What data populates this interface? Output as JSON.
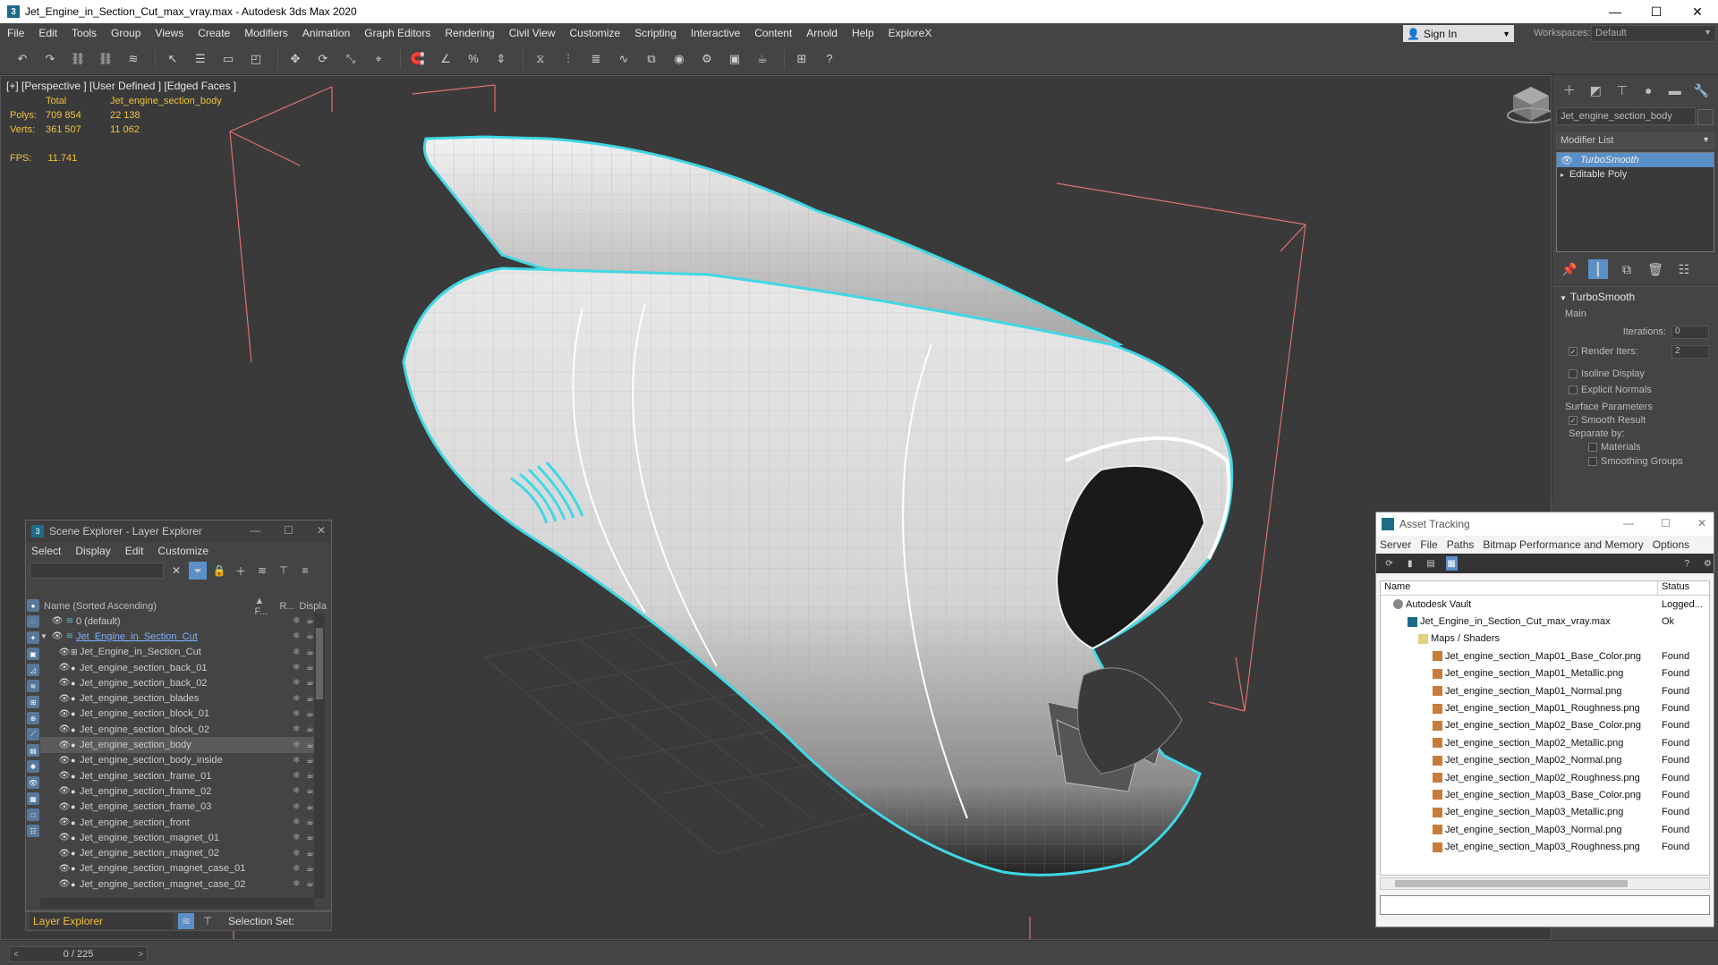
{
  "window": {
    "title": "Jet_Engine_in_Section_Cut_max_vray.max - Autodesk 3ds Max 2020"
  },
  "menu": [
    "File",
    "Edit",
    "Tools",
    "Group",
    "Views",
    "Create",
    "Modifiers",
    "Animation",
    "Graph Editors",
    "Rendering",
    "Civil View",
    "Customize",
    "Scripting",
    "Interactive",
    "Content",
    "Arnold",
    "Help",
    "ExploreX"
  ],
  "account": {
    "sign_in": "Sign In",
    "workspaces_label": "Workspaces:",
    "workspace": "Default"
  },
  "viewport": {
    "label": "[+] [Perspective ] [User Defined ] [Edged Faces ]",
    "stats": {
      "header_total": "Total",
      "header_object": "Jet_engine_section_body",
      "polys_label": "Polys:",
      "polys_total": "709 854",
      "polys_object": "22 138",
      "verts_label": "Verts:",
      "verts_total": "361 507",
      "verts_object": "11 062",
      "fps_label": "FPS:",
      "fps_value": "11.741"
    }
  },
  "command_panel": {
    "object_name": "Jet_engine_section_body",
    "modifier_list": "Modifier List",
    "stack": [
      "TurboSmooth",
      "Editable Poly"
    ],
    "rollout": "TurboSmooth",
    "main": "Main",
    "iterations_label": "Iterations:",
    "iterations_value": "0",
    "render_iters_label": "Render Iters:",
    "render_iters_value": "2",
    "isoline": "Isoline Display",
    "explicit_normals": "Explicit Normals",
    "surface_params": "Surface Parameters",
    "smooth_result": "Smooth Result",
    "separate_by": "Separate by:",
    "materials": "Materials",
    "smoothing_groups": "Smoothing Groups"
  },
  "scene_explorer": {
    "title": "Scene Explorer - Layer Explorer",
    "menu": [
      "Select",
      "Display",
      "Edit",
      "Customize"
    ],
    "col_name": "Name (Sorted Ascending)",
    "col_f": "▲ F...",
    "col_r": "R...",
    "col_disp": "Displa",
    "rows": [
      {
        "label": "0 (default)"
      },
      {
        "label": "Jet_Engine_in_Section_Cut"
      },
      {
        "label": "Jet_Engine_in_Section_Cut"
      },
      {
        "label": "Jet_engine_section_back_01"
      },
      {
        "label": "Jet_engine_section_back_02"
      },
      {
        "label": "Jet_engine_section_blades"
      },
      {
        "label": "Jet_engine_section_block_01"
      },
      {
        "label": "Jet_engine_section_block_02"
      },
      {
        "label": "Jet_engine_section_body"
      },
      {
        "label": "Jet_engine_section_body_inside"
      },
      {
        "label": "Jet_engine_section_frame_01"
      },
      {
        "label": "Jet_engine_section_frame_02"
      },
      {
        "label": "Jet_engine_section_frame_03"
      },
      {
        "label": "Jet_engine_section_front"
      },
      {
        "label": "Jet_engine_section_magnet_01"
      },
      {
        "label": "Jet_engine_section_magnet_02"
      },
      {
        "label": "Jet_engine_section_magnet_case_01"
      },
      {
        "label": "Jet_engine_section_magnet_case_02"
      }
    ],
    "layer_explorer": "Layer Explorer",
    "selection_set": "Selection Set:"
  },
  "asset_tracking": {
    "title": "Asset Tracking",
    "menu": [
      "Server",
      "File",
      "Paths",
      "Bitmap Performance and Memory",
      "Options"
    ],
    "col_name": "Name",
    "col_status": "Status",
    "rows": [
      {
        "name": "Autodesk Vault",
        "status": "Logged..."
      },
      {
        "name": "Jet_Engine_in_Section_Cut_max_vray.max",
        "status": "Ok"
      },
      {
        "name": "Maps / Shaders",
        "status": ""
      },
      {
        "name": "Jet_engine_section_Map01_Base_Color.png",
        "status": "Found"
      },
      {
        "name": "Jet_engine_section_Map01_Metallic.png",
        "status": "Found"
      },
      {
        "name": "Jet_engine_section_Map01_Normal.png",
        "status": "Found"
      },
      {
        "name": "Jet_engine_section_Map01_Roughness.png",
        "status": "Found"
      },
      {
        "name": "Jet_engine_section_Map02_Base_Color.png",
        "status": "Found"
      },
      {
        "name": "Jet_engine_section_Map02_Metallic.png",
        "status": "Found"
      },
      {
        "name": "Jet_engine_section_Map02_Normal.png",
        "status": "Found"
      },
      {
        "name": "Jet_engine_section_Map02_Roughness.png",
        "status": "Found"
      },
      {
        "name": "Jet_engine_section_Map03_Base_Color.png",
        "status": "Found"
      },
      {
        "name": "Jet_engine_section_Map03_Metallic.png",
        "status": "Found"
      },
      {
        "name": "Jet_engine_section_Map03_Normal.png",
        "status": "Found"
      },
      {
        "name": "Jet_engine_section_Map03_Roughness.png",
        "status": "Found"
      }
    ]
  },
  "timeline": {
    "frame": "0 / 225"
  },
  "colors": {
    "accent": "#5b8fc7",
    "stats": "#f0c23b",
    "selection_outline": "#3fd8e6",
    "bbox": "#e07070"
  }
}
